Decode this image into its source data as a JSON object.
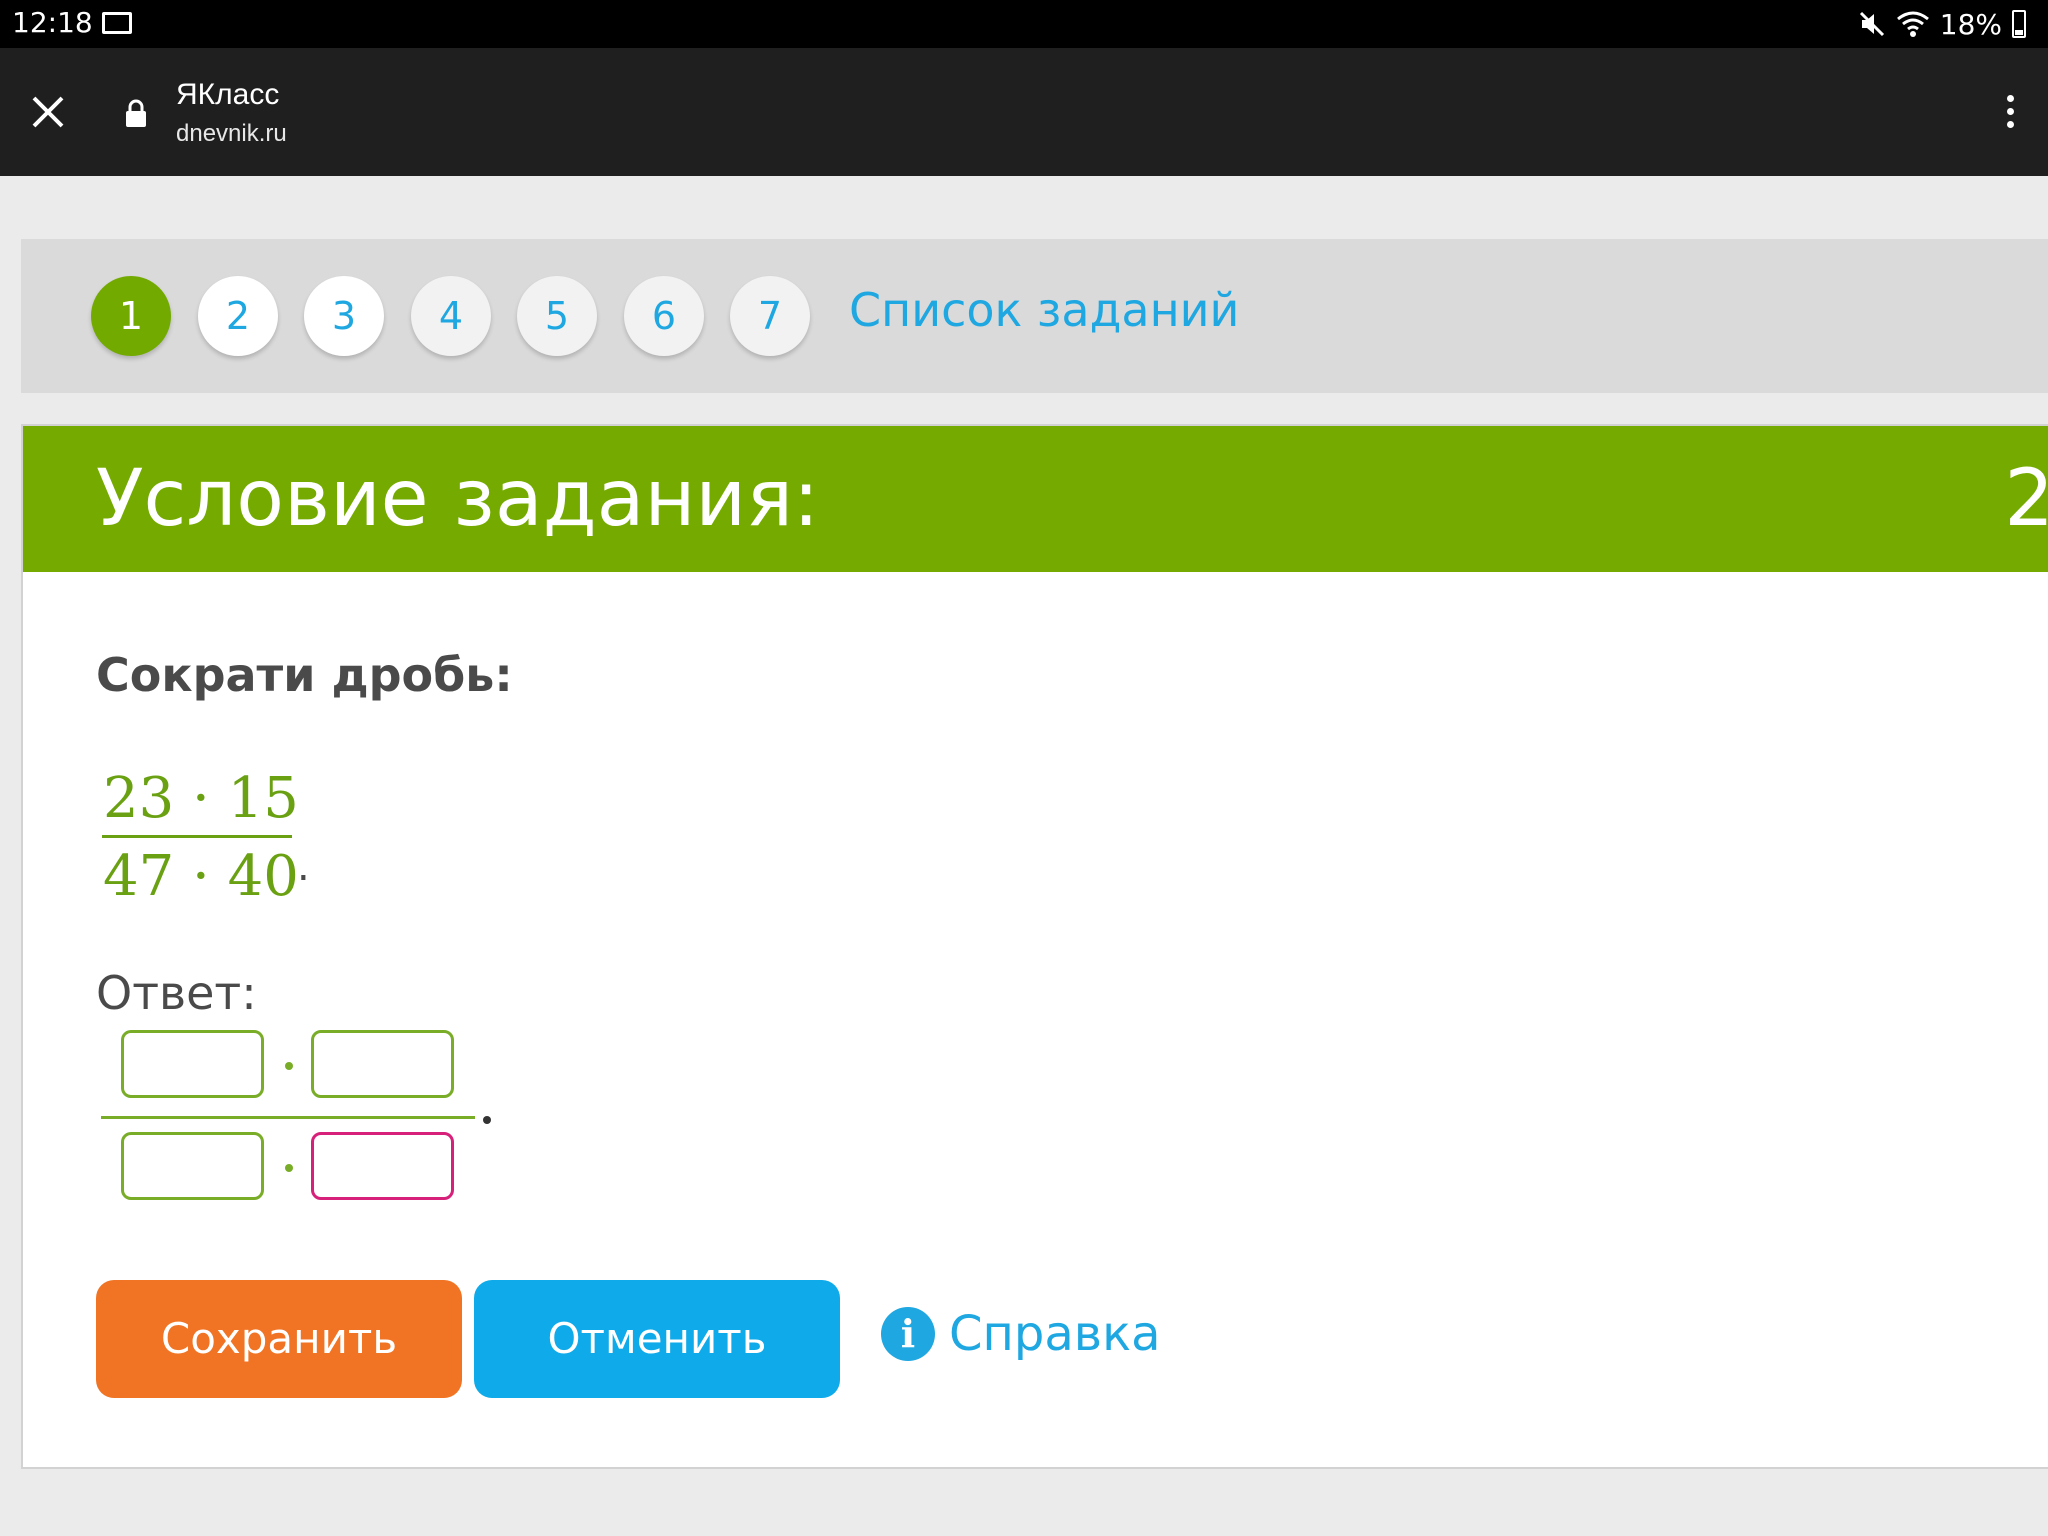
{
  "status_bar": {
    "time": "12:18",
    "battery": "18%",
    "icons": [
      "mail-icon",
      "mute-icon",
      "wifi-icon",
      "battery-icon"
    ]
  },
  "browser": {
    "site_title": "ЯКласс",
    "url": "dnevnik.ru",
    "icons": [
      "close-icon",
      "lock-icon",
      "more-vert-icon"
    ]
  },
  "task_nav": {
    "tasks": [
      "1",
      "2",
      "3",
      "4",
      "5",
      "6",
      "7"
    ],
    "active_task": "1",
    "list_link": "Список заданий"
  },
  "card": {
    "title": "Условие задания:",
    "score": "2",
    "prompt": "Сократи дробь:",
    "fraction": {
      "numerator": "23 · 15",
      "denominator": "47 · 40",
      "period": "."
    },
    "answer_label": "Ответ:",
    "answer_inputs": [
      {
        "value": "",
        "state": "normal"
      },
      {
        "value": "",
        "state": "normal"
      },
      {
        "value": "",
        "state": "normal"
      },
      {
        "value": "",
        "state": "focused"
      }
    ],
    "save_label": "Сохранить",
    "cancel_label": "Отменить",
    "help_label": "Справка"
  },
  "colors": {
    "accent_green": "#75ab00",
    "link_blue": "#1ea7e1",
    "save_orange": "#f07424",
    "cancel_blue": "#0eaaea",
    "focus_pink": "#d6207a"
  }
}
